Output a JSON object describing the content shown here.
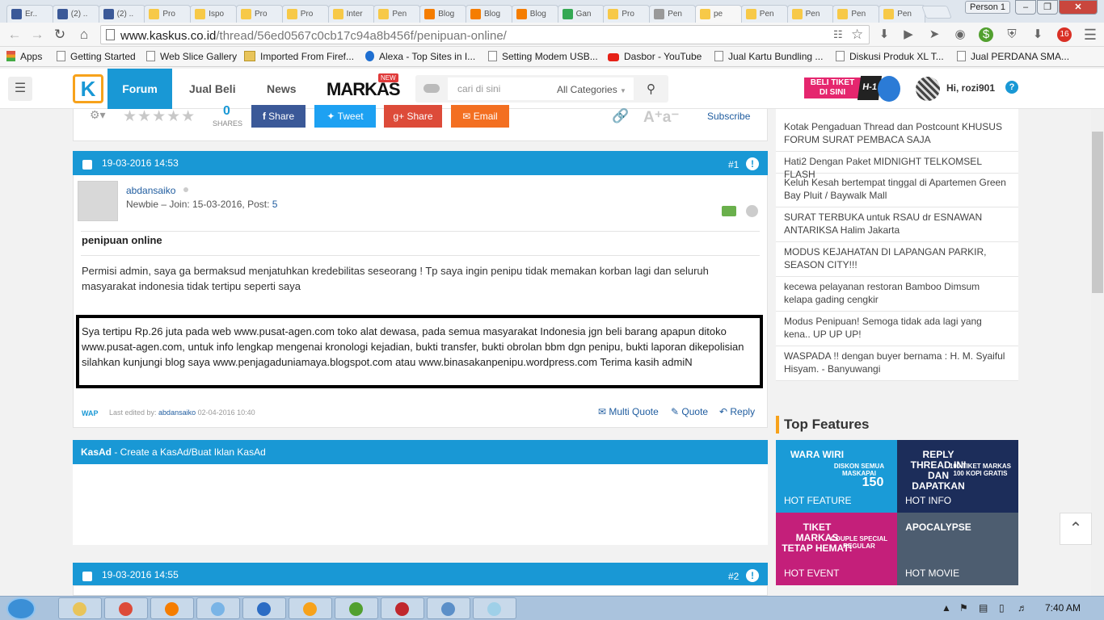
{
  "browser": {
    "tabs": [
      {
        "title": "Er..",
        "color": "#3b5998"
      },
      {
        "title": "(2) ..",
        "color": "#3b5998"
      },
      {
        "title": "(2) ..",
        "color": "#3b5998"
      },
      {
        "title": "Pro",
        "color": "#f7c948"
      },
      {
        "title": "Ispo",
        "color": "#f7c948"
      },
      {
        "title": "Pro",
        "color": "#f7c948"
      },
      {
        "title": "Pro",
        "color": "#f7c948"
      },
      {
        "title": "Inter",
        "color": "#f7c948"
      },
      {
        "title": "Pen",
        "color": "#f7c948"
      },
      {
        "title": "Blog",
        "color": "#f57d00"
      },
      {
        "title": "Blog",
        "color": "#f57d00"
      },
      {
        "title": "Blog",
        "color": "#f57d00"
      },
      {
        "title": "Gan",
        "color": "#34a853"
      },
      {
        "title": "Pro",
        "color": "#f7c948"
      },
      {
        "title": "Pen",
        "color": "#999999"
      },
      {
        "title": "pe",
        "color": "#f7c948"
      },
      {
        "title": "Pen",
        "color": "#f7c948"
      },
      {
        "title": "Pen",
        "color": "#f7c948"
      },
      {
        "title": "Pen",
        "color": "#f7c948"
      },
      {
        "title": "Pen",
        "color": "#f7c948"
      }
    ],
    "profile": "Person 1",
    "url_domain": "www.kaskus.co.id",
    "url_path": "/thread/56ed0567c0cb17c94a8b456f/penipuan-online/",
    "extension_badge": "16",
    "bookmarks": [
      "Apps",
      "Getting Started",
      "Web Slice Gallery",
      "Imported From Firef...",
      "Alexa - Top Sites in I...",
      "Setting Modem USB...",
      "Dasbor - YouTube",
      "Jual Kartu Bundling ...",
      "Diskusi Produk XL T...",
      "Jual PERDANA SMA..."
    ]
  },
  "header": {
    "logo": "K",
    "nav": [
      "Forum",
      "Jual Beli",
      "News"
    ],
    "markas": "MARKAS",
    "markas_badge": "NEW",
    "search_placeholder": "cari di sini",
    "category": "All Categories",
    "promo_line1": "BELI TIKET",
    "promo_line2": "DI SINI",
    "promo_tag": "H-1",
    "greeting": "Hi, rozi901"
  },
  "sharebar": {
    "share_count": "0",
    "shares_label": "SHARES",
    "buttons": [
      "Share",
      "Tweet",
      "Share",
      "Email"
    ],
    "subscribe": "Subscribe",
    "font_size": "A⁺a⁻"
  },
  "post1": {
    "datetime": "19-03-2016 14:53",
    "number": "#1",
    "username": "abdansaiko",
    "user_meta": "Newbie – Join: 15-03-2016, Post: ",
    "post_count": "5",
    "title": "penipuan online",
    "paragraph1": "Permisi admin, saya ga bermaksud menjatuhkan kredebilitas seseorang ! Tp saya ingin penipu tidak memakan korban lagi dan seluruh masyarakat indonesia tidak tertipu seperti saya",
    "paragraph2": "Sya tertipu Rp.26 juta pada web www.pusat-agen.com toko alat dewasa, pada semua masyarakat Indonesia jgn beli barang apapun ditoko www.pusat-agen.com, untuk info lengkap mengenai kronologi kejadian, bukti transfer, bukti obrolan bbm dgn penipu, bukti laporan dikepolisian silahkan kunjungi blog saya www.penjagaduniamaya.blogspot.com atau www.binasakanpenipu.wordpress.com Terima kasih admiN",
    "wap": "WAP",
    "edited_prefix": "Last edited by: ",
    "edited_user": "abdansaiko",
    "edited_date": " 02-04-2016 10:40",
    "actions": [
      "Multi Quote",
      "Quote",
      "Reply"
    ]
  },
  "kasad": {
    "label": "KasAd",
    "text": " - Create a KasAd/Buat Iklan KasAd"
  },
  "post2": {
    "datetime": "19-03-2016 14:55",
    "number": "#2"
  },
  "sidebar": {
    "threads": [
      "Kotak Pengaduan Thread dan Postcount KHUSUS FORUM SURAT PEMBACA SAJA",
      "Hati2 Dengan Paket MIDNIGHT TELKOMSEL FLASH",
      "Keluh Kesah bertempat tinggal di Apartemen Green Bay Pluit / Baywalk Mall",
      "SURAT TERBUKA untuk RSAU dr ESNAWAN ANTARIKSA Halim Jakarta",
      "MODUS KEJAHATAN DI LAPANGAN PARKIR, SEASON CITY!!!",
      "kecewa pelayanan restoran Bamboo Dimsum kelapa gading cengkir",
      "Modus Penipuan! Semoga tidak ada lagi yang kena.. UP UP UP!",
      "WASPADA !! dengan buyer bernama : H. M. Syaiful Hisyam. - Banyuwangi"
    ],
    "top_features_title": "Top Features",
    "features": [
      {
        "label": "HOT FEATURE",
        "headline": "WARA WIRI",
        "headline2": "DISKON SEMUA MASKAPAI",
        "headline3": "150",
        "color": "#1a9bd7"
      },
      {
        "label": "HOT INFO",
        "headline": "REPLY THREAD INI DAN DAPATKAN",
        "headline2": "100 TIKET MARKAS 100 KOPI GRATIS",
        "headline3": "",
        "color": "#1c2d5a"
      },
      {
        "label": "HOT EVENT",
        "headline": "TIKET MARKAS TETAP HEMAT!",
        "headline2": "COUPLE  SPECIAL  REGULAR",
        "headline3": "",
        "color": "#c41f7a"
      },
      {
        "label": "HOT MOVIE",
        "headline": "APOCALYPSE",
        "headline2": "",
        "headline3": "",
        "color": "#4d5d70"
      }
    ]
  },
  "taskbar": {
    "time": "7:40 AM"
  }
}
